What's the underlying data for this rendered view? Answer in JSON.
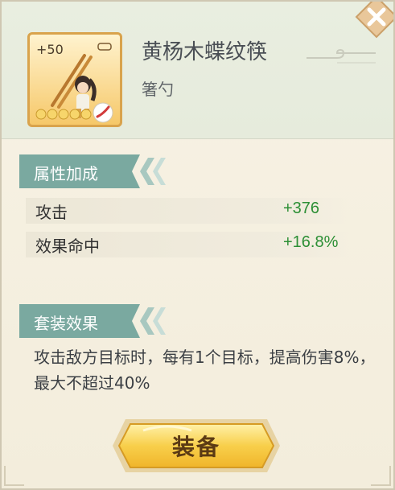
{
  "item": {
    "level_badge": "+50",
    "name": "黄杨木蝶纹筷",
    "type": "箸勺"
  },
  "attributes": {
    "section_title": "属性加成",
    "rows": [
      {
        "label": "攻击",
        "value": "+376"
      },
      {
        "label": "效果命中",
        "value": "+16.8%"
      }
    ]
  },
  "set_effect": {
    "section_title": "套装效果",
    "description": "攻击敌方目标时，每有1个目标，提高伤害8%，最大不超过40%"
  },
  "equip_button": {
    "label": "装备"
  },
  "icons": [
    "close-icon",
    "star-icon",
    "red-feather-badge-icon",
    "chopsticks-icon",
    "character-icon"
  ],
  "colors": {
    "accent": "#6fa79a",
    "value_green": "#2c8f35",
    "button_yellow": "#f6c43f"
  }
}
